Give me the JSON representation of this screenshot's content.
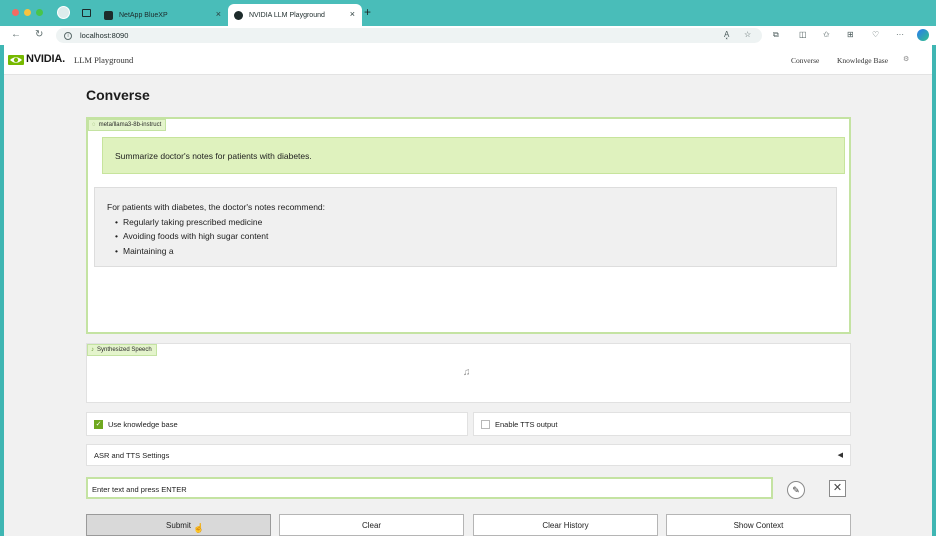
{
  "browser": {
    "tabs": [
      {
        "title": "NetApp BlueXP",
        "close": "×"
      },
      {
        "title": "NVIDIA LLM Playground",
        "close": "×"
      }
    ],
    "new_tab": "+",
    "url": "localhost:8090",
    "nav": {
      "back": "←",
      "reload": "↻"
    },
    "tools": {
      "read_aloud": "A͓",
      "favorite": "☆",
      "extensions": "⧉",
      "split": "◫",
      "favorites": "✩",
      "collections": "⊞",
      "more": "···"
    }
  },
  "header": {
    "brand": "NVIDIA.",
    "app_title": "LLM Playground",
    "nav_links": [
      "Converse",
      "Knowledge Base"
    ],
    "settings_icon": "⚙"
  },
  "page_title": "Converse",
  "chat": {
    "model_label": "meta/llama3-8b-instruct",
    "user_message": "Summarize doctor's notes for patients with diabetes.",
    "bot_intro": "For patients with diabetes, the doctor's notes recommend:",
    "bot_bullets": [
      "Regularly taking prescribed medicine",
      "Avoiding foods with high sugar content",
      "Maintaining a"
    ]
  },
  "speech": {
    "label": "Synthesized Speech",
    "icon": "♫"
  },
  "options": {
    "use_kb_label": "Use knowledge base",
    "use_kb_checked": true,
    "tts_label": "Enable TTS output",
    "tts_checked": false,
    "check_glyph": "✓"
  },
  "accordion": {
    "label": "ASR and TTS Settings",
    "arrow": "◀"
  },
  "input": {
    "placeholder": "Enter text and press ENTER",
    "value": "",
    "pen_icon": "✎",
    "clear_icon": "✕"
  },
  "buttons": {
    "submit": "Submit",
    "clear": "Clear",
    "clear_history": "Clear History",
    "show_context": "Show Context"
  },
  "colors": {
    "accent_green": "#76b900",
    "panel_border": "#c4e3a2",
    "user_bubble": "#dff2be",
    "chrome_teal": "#49bdb9"
  }
}
